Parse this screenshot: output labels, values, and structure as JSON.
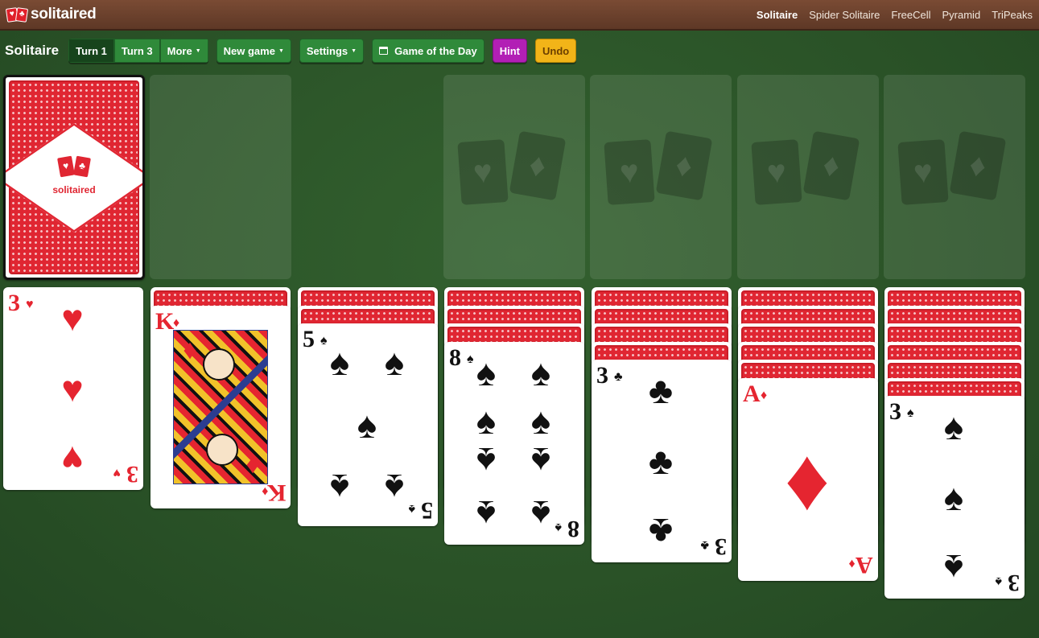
{
  "brand": {
    "name": "solitaired"
  },
  "nav": [
    {
      "label": "Solitaire",
      "active": true
    },
    {
      "label": "Spider Solitaire",
      "active": false
    },
    {
      "label": "FreeCell",
      "active": false
    },
    {
      "label": "Pyramid",
      "active": false
    },
    {
      "label": "TriPeaks",
      "active": false
    }
  ],
  "toolbar": {
    "title": "Solitaire",
    "turn1": "Turn 1",
    "turn3": "Turn 3",
    "more": "More",
    "new_game": "New game",
    "settings": "Settings",
    "game_of_day": "Game of the Day",
    "hint": "Hint",
    "undo": "Undo"
  },
  "colors": {
    "accent_green": "#2f8a3a",
    "hint": "#b21fb5",
    "undo": "#f2b418",
    "felt": "#2b5428",
    "card_red": "#e52530"
  },
  "tableau": [
    {
      "hidden": 0,
      "face": {
        "rank": "3",
        "suit": "♥",
        "color": "red"
      }
    },
    {
      "hidden": 1,
      "face": {
        "rank": "K",
        "suit": "♦",
        "color": "red"
      }
    },
    {
      "hidden": 2,
      "face": {
        "rank": "5",
        "suit": "♠",
        "color": "black"
      }
    },
    {
      "hidden": 3,
      "face": {
        "rank": "8",
        "suit": "♠",
        "color": "black"
      }
    },
    {
      "hidden": 4,
      "face": {
        "rank": "3",
        "suit": "♣",
        "color": "black"
      }
    },
    {
      "hidden": 5,
      "face": {
        "rank": "A",
        "suit": "♦",
        "color": "red"
      }
    },
    {
      "hidden": 6,
      "face": {
        "rank": "3",
        "suit": "♠",
        "color": "black"
      }
    }
  ]
}
